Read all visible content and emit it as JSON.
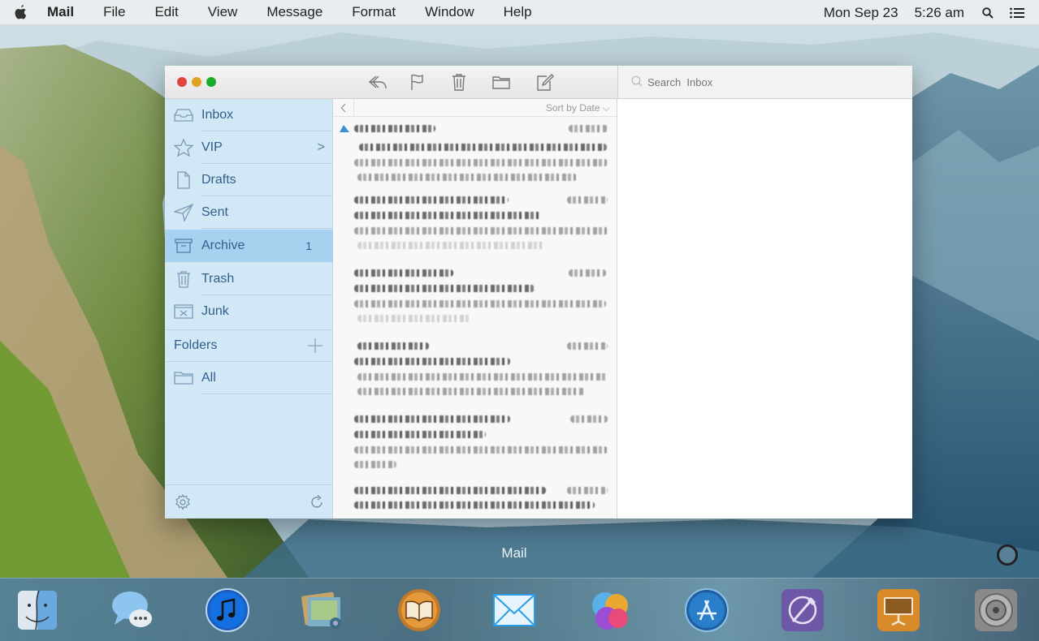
{
  "menubar": {
    "app_name": "Mail",
    "items": [
      "File",
      "Edit",
      "View",
      "Message",
      "Format",
      "Window",
      "Help"
    ],
    "date": "Mon Sep 23",
    "time": "5:26 am"
  },
  "window": {
    "search_placeholder": "Search  Inbox",
    "toolbar_icons": [
      "reply-icon",
      "flag-icon",
      "trash-icon",
      "folder-icon",
      "compose-icon"
    ]
  },
  "sidebar": {
    "items": [
      {
        "label": "Inbox",
        "icon": "inbox-icon"
      },
      {
        "label": "VIP",
        "icon": "star-icon",
        "chevron": ">"
      },
      {
        "label": "Drafts",
        "icon": "draft-icon"
      },
      {
        "label": "Sent",
        "icon": "paper-plane-icon"
      },
      {
        "label": "Archive",
        "icon": "archive-icon",
        "count": "1",
        "active": true
      },
      {
        "label": "Trash",
        "icon": "trash-icon"
      },
      {
        "label": "Junk",
        "icon": "junk-icon"
      }
    ],
    "folders_label": "Folders",
    "folder_items": [
      {
        "label": "All",
        "icon": "folder-icon"
      }
    ]
  },
  "message_list": {
    "sort_label": "Sort by Date"
  },
  "dock": {
    "label": "Mail",
    "apps": [
      "finder-icon",
      "messages-icon",
      "itunes-icon",
      "photos-icon",
      "ibooks-icon",
      "mail-icon",
      "game-center-icon",
      "app-store-icon",
      "settings-app-icon",
      "presentation-icon",
      "system-preferences-icon"
    ]
  },
  "colors": {
    "sidebar_bg": "#d3e8f7",
    "sidebar_active": "#a8d1f0",
    "sidebar_text": "#2f5f8a",
    "close": "#e0443e",
    "minimize": "#dea123",
    "zoom": "#1aab29"
  }
}
